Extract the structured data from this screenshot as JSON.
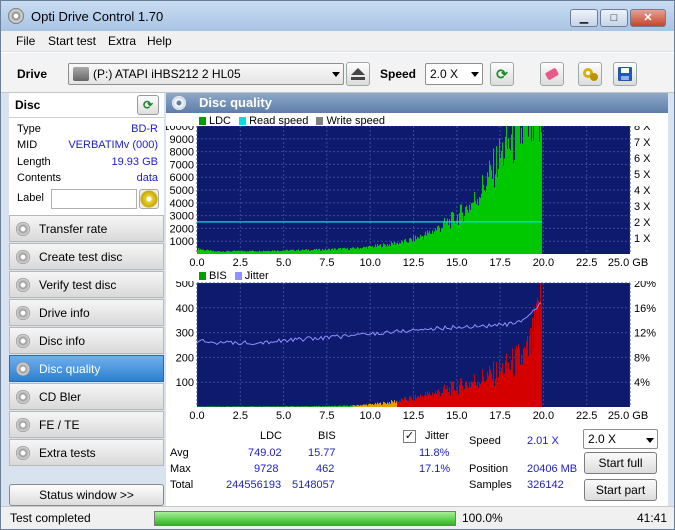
{
  "window": {
    "title": "Opti Drive Control 1.70",
    "minimize": "▁",
    "maximize": "□",
    "close": "✕"
  },
  "menu": [
    "File",
    "Start test",
    "Extra",
    "Help"
  ],
  "toolbar": {
    "drive_label": "Drive",
    "drive_value": "(P:)   ATAPI iHBS212   2 HL05",
    "speed_label": "Speed",
    "speed_value": "2.0 X"
  },
  "disc": {
    "header": "Disc",
    "rows": [
      {
        "key": "Type",
        "value": "BD-R"
      },
      {
        "key": "MID",
        "value": "VERBATIMv (000)"
      },
      {
        "key": "Length",
        "value": "19.93 GB"
      },
      {
        "key": "Contents",
        "value": "data"
      }
    ],
    "label_key": "Label",
    "label_value": ""
  },
  "nav": {
    "items": [
      "Transfer rate",
      "Create test disc",
      "Verify test disc",
      "Drive info",
      "Disc info",
      "Disc quality",
      "CD Bler",
      "FE / TE",
      "Extra tests"
    ],
    "active": "Disc quality",
    "status_window": "Status window >>"
  },
  "panel": {
    "title": "Disc quality"
  },
  "colors": {
    "ldc": "#00c800",
    "read_speed": "#00e0e0",
    "write_speed": "#808080",
    "bis": "#d40000",
    "jitter": "#9090ff",
    "plot_bg": "#0d1a6e"
  },
  "chart_data": [
    {
      "type": "bar",
      "legend": [
        "LDC",
        "Read speed",
        "Write speed"
      ],
      "x_ticks": [
        "0.0",
        "2.5",
        "5.0",
        "7.5",
        "10.0",
        "12.5",
        "15.0",
        "17.5",
        "20.0",
        "22.5",
        "25.0 GB"
      ],
      "y_ticks_left": [
        "10000",
        "9000",
        "8000",
        "7000",
        "6000",
        "5000",
        "4000",
        "3000",
        "2000",
        "1000"
      ],
      "y_ticks_right": [
        "8 X",
        "7 X",
        "6 X",
        "5 X",
        "4 X",
        "3 X",
        "2 X",
        "1 X"
      ],
      "xlim": [
        0,
        25
      ],
      "ylim": [
        0,
        10000
      ],
      "y2lim": [
        0,
        8
      ],
      "series": [
        {
          "name": "LDC",
          "x": [
            0,
            1,
            2,
            3,
            4,
            5,
            6,
            7,
            8,
            9,
            10,
            11,
            12,
            13,
            13.5,
            14,
            14.5,
            15,
            15.5,
            16,
            16.5,
            17,
            17.5,
            18,
            18.5,
            19,
            19.93
          ],
          "values": [
            400,
            200,
            220,
            240,
            260,
            280,
            300,
            330,
            380,
            430,
            550,
            750,
            950,
            1400,
            1700,
            2100,
            2500,
            2900,
            3500,
            4200,
            5300,
            6400,
            7700,
            8600,
            9200,
            9700,
            9728
          ]
        },
        {
          "name": "Read speed",
          "x": [
            0,
            19.93
          ],
          "values": [
            2.01,
            2.01
          ]
        }
      ]
    },
    {
      "type": "bar",
      "legend": [
        "BIS",
        "Jitter"
      ],
      "x_ticks": [
        "0.0",
        "2.5",
        "5.0",
        "7.5",
        "10.0",
        "12.5",
        "15.0",
        "17.5",
        "20.0",
        "22.5",
        "25.0 GB"
      ],
      "y_ticks_left": [
        "500",
        "400",
        "300",
        "200",
        "100"
      ],
      "y_ticks_right": [
        "20%",
        "16%",
        "12%",
        "8%",
        "4%"
      ],
      "xlim": [
        0,
        25
      ],
      "ylim": [
        0,
        500
      ],
      "y2lim": [
        0,
        20
      ],
      "series": [
        {
          "name": "BIS",
          "x": [
            0,
            2,
            4,
            6,
            8,
            9,
            10,
            11,
            12,
            13,
            14,
            15,
            16,
            17,
            18,
            19,
            19.5,
            19.93
          ],
          "values": [
            2,
            2,
            3,
            3,
            4,
            6,
            10,
            18,
            30,
            45,
            62,
            80,
            105,
            130,
            165,
            210,
            290,
            462
          ]
        },
        {
          "name": "Jitter",
          "x": [
            0,
            2,
            4,
            6,
            8,
            10,
            12,
            14,
            16,
            18,
            19,
            19.93
          ],
          "values": [
            10.6,
            10.3,
            10.5,
            10.9,
            11.3,
            11.8,
            12.3,
            12.7,
            13.0,
            13.3,
            14.0,
            17.1
          ]
        }
      ]
    }
  ],
  "stats": {
    "col_ldc": "LDC",
    "col_bis": "BIS",
    "col_jitter": "Jitter",
    "jitter_checked": "✓",
    "avg_label": "Avg",
    "max_label": "Max",
    "total_label": "Total",
    "avg_ldc": "749.02",
    "avg_bis": "15.77",
    "avg_jitter": "11.8%",
    "max_ldc": "9728",
    "max_bis": "462",
    "max_jitter": "17.1%",
    "total_ldc": "244556193",
    "total_bis": "5148057",
    "speed_label": "Speed",
    "speed_value": "2.01 X",
    "position_label": "Position",
    "position_value": "20406 MB",
    "samples_label": "Samples",
    "samples_value": "326142",
    "speed_combo": "2.0 X",
    "start_full": "Start full",
    "start_part": "Start part"
  },
  "statusbar": {
    "text": "Test completed",
    "progress": 100.0,
    "progress_text": "100.0%",
    "time": "41:41"
  }
}
